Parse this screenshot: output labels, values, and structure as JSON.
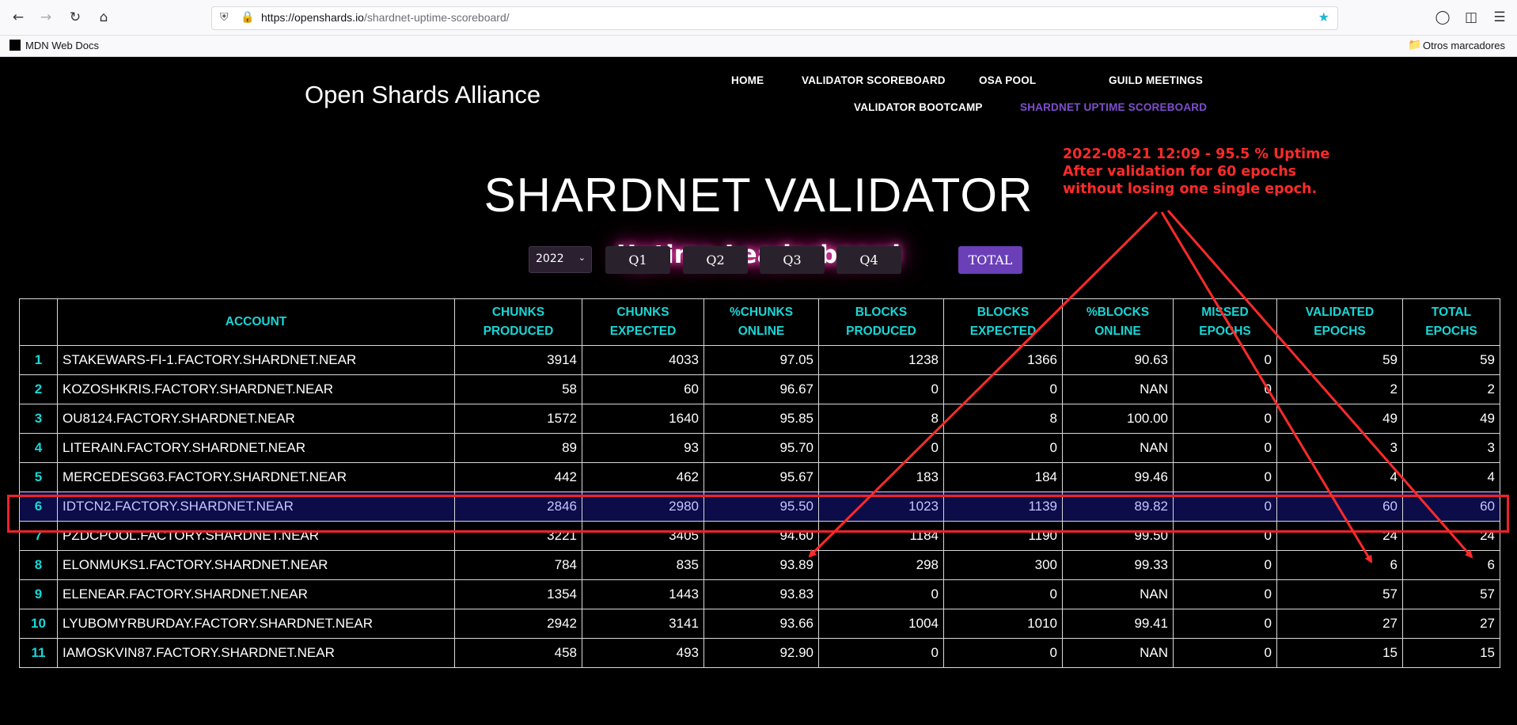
{
  "browser": {
    "url_host": "https://openshards.io",
    "url_path": "/shardnet-uptime-scoreboard/",
    "bookmark_left": "MDN Web Docs",
    "bookmark_right": "Otros marcadores"
  },
  "site": {
    "title": "Open Shards Alliance",
    "nav": {
      "home": "HOME",
      "validator_scoreboard": "VALIDATOR SCOREBOARD",
      "osa_pool": "OSA POOL",
      "guild_meetings": "GUILD MEETINGS",
      "validator_bootcamp": "VALIDATOR BOOTCAMP",
      "shardnet_uptime": "SHARDNET UPTIME SCOREBOARD"
    }
  },
  "annotation": {
    "line1": "2022-08-21 12:09 -  95.5 % Uptime",
    "line2": "After validation for 60 epochs",
    "line3": "without losing one single epoch.",
    "color": "#ff2a2a"
  },
  "hero": {
    "title": "SHARDNET VALIDATOR",
    "subtitle": "Uptime Leaderboard"
  },
  "filters": {
    "year": "2022",
    "q1": "Q1",
    "q2": "Q2",
    "q3": "Q3",
    "q4": "Q4",
    "total": "TOTAL"
  },
  "table": {
    "headers": {
      "account": "ACCOUNT",
      "chunks_produced_1": "CHUNKS",
      "chunks_produced_2": "PRODUCED",
      "chunks_expected_1": "CHUNKS",
      "chunks_expected_2": "EXPECTED",
      "pct_chunks_1": "%CHUNKS",
      "pct_chunks_2": "ONLINE",
      "blocks_produced_1": "BLOCKS",
      "blocks_produced_2": "PRODUCED",
      "blocks_expected_1": "BLOCKS",
      "blocks_expected_2": "EXPECTED",
      "pct_blocks_1": "%BLOCKS",
      "pct_blocks_2": "ONLINE",
      "missed_1": "MISSED",
      "missed_2": "EPOCHS",
      "validated_1": "VALIDATED",
      "validated_2": "EPOCHS",
      "total_1": "TOTAL",
      "total_2": "EPOCHS"
    },
    "rows": [
      [
        "1",
        "STAKEWARS-FI-1.FACTORY.SHARDNET.NEAR",
        "3914",
        "4033",
        "97.05",
        "1238",
        "1366",
        "90.63",
        "0",
        "59",
        "59"
      ],
      [
        "2",
        "KOZOSHKRIS.FACTORY.SHARDNET.NEAR",
        "58",
        "60",
        "96.67",
        "0",
        "0",
        "NAN",
        "0",
        "2",
        "2"
      ],
      [
        "3",
        "OU8124.FACTORY.SHARDNET.NEAR",
        "1572",
        "1640",
        "95.85",
        "8",
        "8",
        "100.00",
        "0",
        "49",
        "49"
      ],
      [
        "4",
        "LITERAIN.FACTORY.SHARDNET.NEAR",
        "89",
        "93",
        "95.70",
        "0",
        "0",
        "NAN",
        "0",
        "3",
        "3"
      ],
      [
        "5",
        "MERCEDESG63.FACTORY.SHARDNET.NEAR",
        "442",
        "462",
        "95.67",
        "183",
        "184",
        "99.46",
        "0",
        "4",
        "4"
      ],
      [
        "6",
        "IDTCN2.FACTORY.SHARDNET.NEAR",
        "2846",
        "2980",
        "95.50",
        "1023",
        "1139",
        "89.82",
        "0",
        "60",
        "60"
      ],
      [
        "7",
        "PZDCPOOL.FACTORY.SHARDNET.NEAR",
        "3221",
        "3405",
        "94.60",
        "1184",
        "1190",
        "99.50",
        "0",
        "24",
        "24"
      ],
      [
        "8",
        "ELONMUKS1.FACTORY.SHARDNET.NEAR",
        "784",
        "835",
        "93.89",
        "298",
        "300",
        "99.33",
        "0",
        "6",
        "6"
      ],
      [
        "9",
        "ELENEAR.FACTORY.SHARDNET.NEAR",
        "1354",
        "1443",
        "93.83",
        "0",
        "0",
        "NAN",
        "0",
        "57",
        "57"
      ],
      [
        "10",
        "LYUBOMYRBURDAY.FACTORY.SHARDNET.NEAR",
        "2942",
        "3141",
        "93.66",
        "1004",
        "1010",
        "99.41",
        "0",
        "27",
        "27"
      ],
      [
        "11",
        "IAMOSKVIN87.FACTORY.SHARDNET.NEAR",
        "458",
        "493",
        "92.90",
        "0",
        "0",
        "NAN",
        "0",
        "15",
        "15"
      ]
    ],
    "highlight_row": 6
  },
  "colors": {
    "header_text": "#19d6d6",
    "active_nav": "#7f4fd0",
    "highlight_bg": "#0c0c48",
    "annotation_red": "#ff2a2a"
  },
  "icons": {
    "back": "back-arrow-icon",
    "forward": "forward-arrow-icon",
    "reload": "reload-icon",
    "home": "home-icon",
    "shield": "shield-icon",
    "lock": "lock-icon",
    "bookmark_star": "star-icon",
    "pocket": "pocket-icon",
    "sidebar": "sidebar-icon",
    "menu": "hamburger-menu-icon",
    "folder": "folder-icon"
  }
}
